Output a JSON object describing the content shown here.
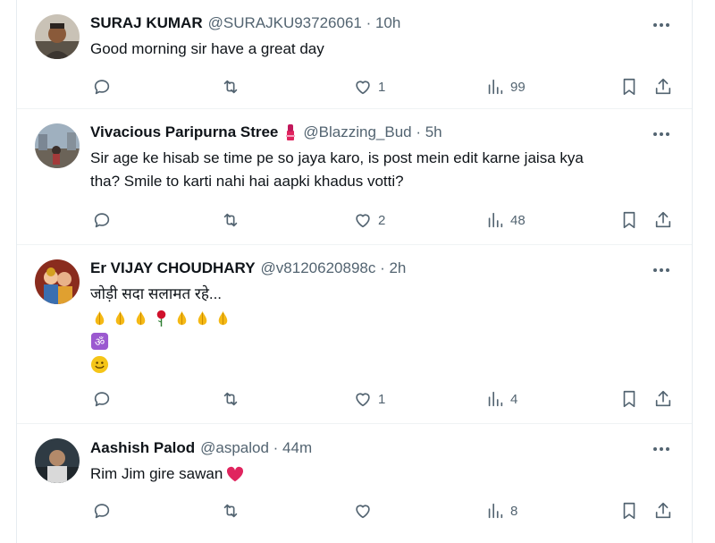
{
  "tweets": [
    {
      "name": "SURAJ KUMAR",
      "meta": "@SURAJKU93726061 · 10h",
      "lines": [
        "Good morning sir have a great day"
      ],
      "replies": "",
      "retweets": "",
      "likes": "1",
      "views": "99"
    },
    {
      "name": "Vivacious Paripurna Stree",
      "meta": "@Blazzing_Bud · 5h",
      "lines": [
        "Sir age ke hisab se time pe so jaya karo, is post mein edit karne jaisa kya",
        "tha? Smile to karti nahi hai aapki khadus votti?"
      ],
      "replies": "",
      "retweets": "",
      "likes": "2",
      "views": "48"
    },
    {
      "name": "Er VIJAY CHOUDHARY",
      "meta": "@v8120620898c · 2h",
      "lines": [
        "जोड़ी सदा सलामत रहे..."
      ],
      "emoji_rows": [
        [
          "folded-hands",
          "folded-hands",
          "folded-hands",
          "rose",
          "folded-hands",
          "folded-hands",
          "folded-hands"
        ],
        [
          "om"
        ],
        [
          "smiley"
        ]
      ],
      "replies": "",
      "retweets": "",
      "likes": "1",
      "views": "4"
    },
    {
      "name": "Aashish Palod",
      "meta": "@aspalod · 44m",
      "lines": [
        "Rim Jim gire sawan"
      ],
      "trailing_emoji": "red-heart",
      "replies": "",
      "retweets": "",
      "likes": "",
      "views": "8"
    }
  ],
  "icons": {
    "reply": "reply-icon",
    "retweet": "retweet-icon",
    "like": "heart-icon",
    "views": "views-icon",
    "bookmark": "bookmark-icon",
    "share": "share-icon",
    "more": "more-icon"
  },
  "colors": {
    "text": "#0f1419",
    "secondary": "#536471",
    "divider": "#eff3f4",
    "heart_red": "#e0245e"
  }
}
